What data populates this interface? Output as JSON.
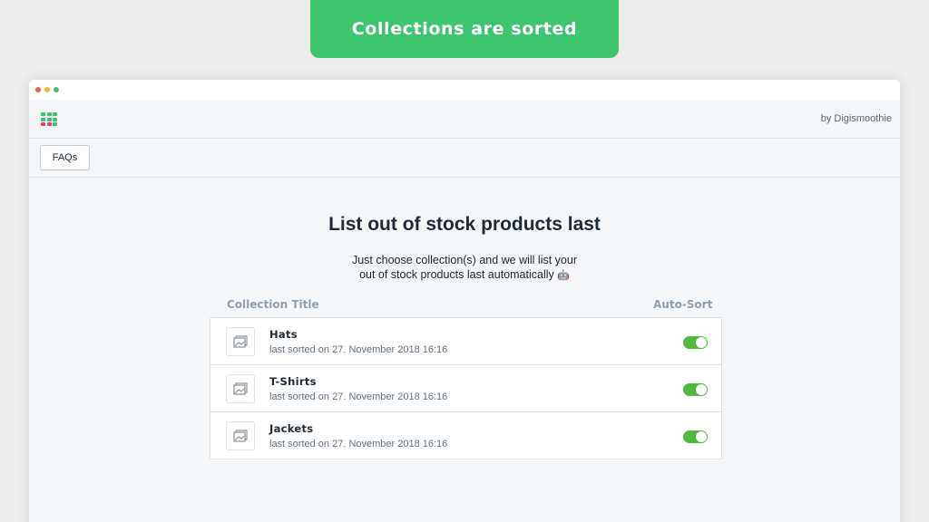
{
  "banner": {
    "text": "Collections are sorted"
  },
  "app": {
    "byline": "by Digismoothie"
  },
  "toolbar": {
    "faq_label": "FAQs"
  },
  "main": {
    "title": "List out of stock products last",
    "subtitle_line1": "Just choose collection(s) and we will list your",
    "subtitle_line2": "out of stock products last automatically",
    "subtitle_emoji": "🤖",
    "col_title": "Collection Title",
    "col_autosort": "Auto-Sort"
  },
  "collections": [
    {
      "title": "Hats",
      "last_sorted": "last sorted on 27. November 2018 16:16",
      "auto_sort": true
    },
    {
      "title": "T-Shirts",
      "last_sorted": "last sorted on 27. November 2018 16:16",
      "auto_sort": true
    },
    {
      "title": "Jackets",
      "last_sorted": "last sorted on 27. November 2018 16:16",
      "auto_sort": true
    }
  ],
  "colors": {
    "accent_green": "#3ec46d",
    "toggle_on": "#50b83c",
    "logo_pink": "#e8436e"
  },
  "icons": {
    "thumbnail": "image-placeholder-icon",
    "logo": "grid-logo-icon"
  }
}
